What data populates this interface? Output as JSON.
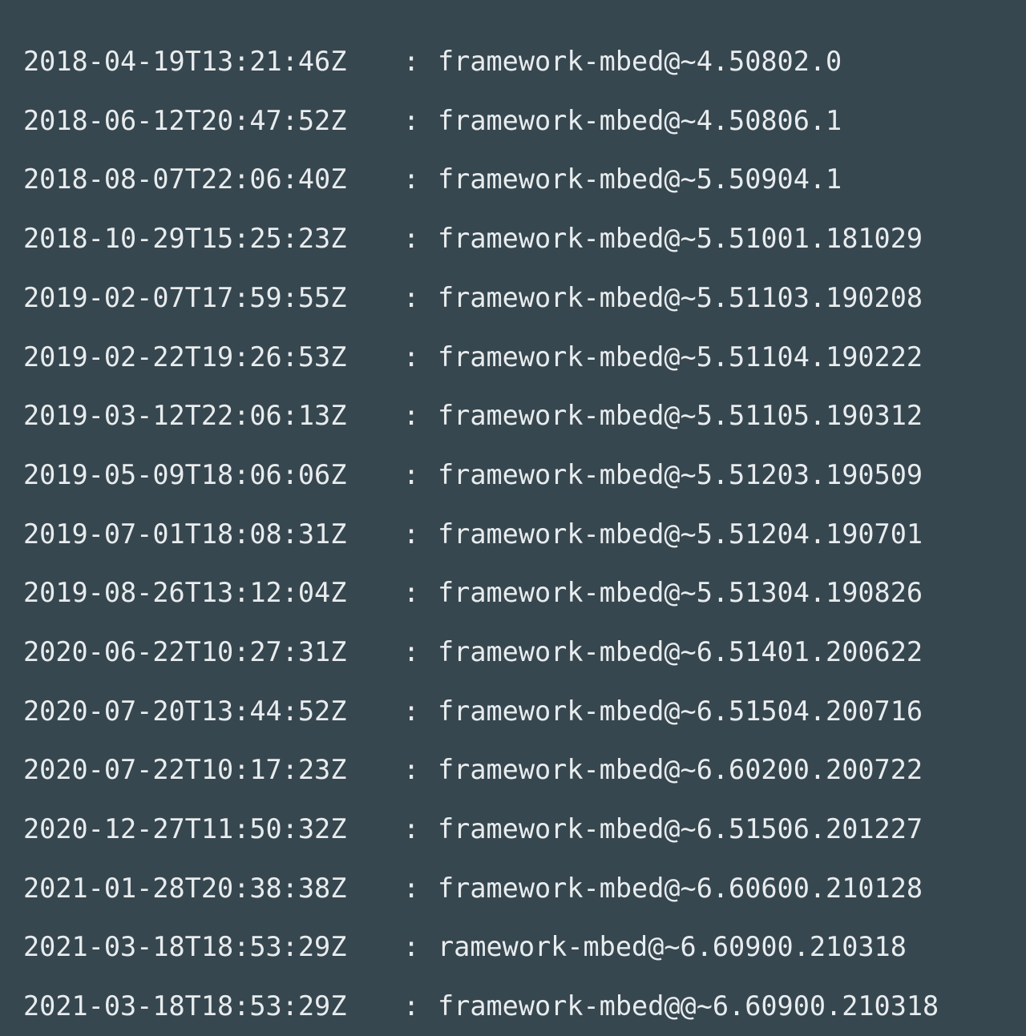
{
  "log": {
    "separator": ":",
    "entries": [
      {
        "timestamp": "2018-04-19T13:21:46Z",
        "package": "framework-mbed@~4.50802.0"
      },
      {
        "timestamp": "2018-06-12T20:47:52Z",
        "package": "framework-mbed@~4.50806.1"
      },
      {
        "timestamp": "2018-08-07T22:06:40Z",
        "package": "framework-mbed@~5.50904.1"
      },
      {
        "timestamp": "2018-10-29T15:25:23Z",
        "package": "framework-mbed@~5.51001.181029"
      },
      {
        "timestamp": "2019-02-07T17:59:55Z",
        "package": "framework-mbed@~5.51103.190208"
      },
      {
        "timestamp": "2019-02-22T19:26:53Z",
        "package": "framework-mbed@~5.51104.190222"
      },
      {
        "timestamp": "2019-03-12T22:06:13Z",
        "package": "framework-mbed@~5.51105.190312"
      },
      {
        "timestamp": "2019-05-09T18:06:06Z",
        "package": "framework-mbed@~5.51203.190509"
      },
      {
        "timestamp": "2019-07-01T18:08:31Z",
        "package": "framework-mbed@~5.51204.190701"
      },
      {
        "timestamp": "2019-08-26T13:12:04Z",
        "package": "framework-mbed@~5.51304.190826"
      },
      {
        "timestamp": "2020-06-22T10:27:31Z",
        "package": "framework-mbed@~6.51401.200622"
      },
      {
        "timestamp": "2020-07-20T13:44:52Z",
        "package": "framework-mbed@~6.51504.200716"
      },
      {
        "timestamp": "2020-07-22T10:17:23Z",
        "package": "framework-mbed@~6.60200.200722"
      },
      {
        "timestamp": "2020-12-27T11:50:32Z",
        "package": "framework-mbed@~6.51506.201227"
      },
      {
        "timestamp": "2021-01-28T20:38:38Z",
        "package": "framework-mbed@~6.60600.210128"
      },
      {
        "timestamp": "2021-03-18T18:53:29Z",
        "package": "ramework-mbed@~6.60900.210318"
      },
      {
        "timestamp": "2021-03-18T18:53:29Z",
        "package": "framework-mbed@@~6.60900.210318"
      }
    ]
  },
  "colors": {
    "background": "#37474f",
    "text": "#e8ecee"
  }
}
